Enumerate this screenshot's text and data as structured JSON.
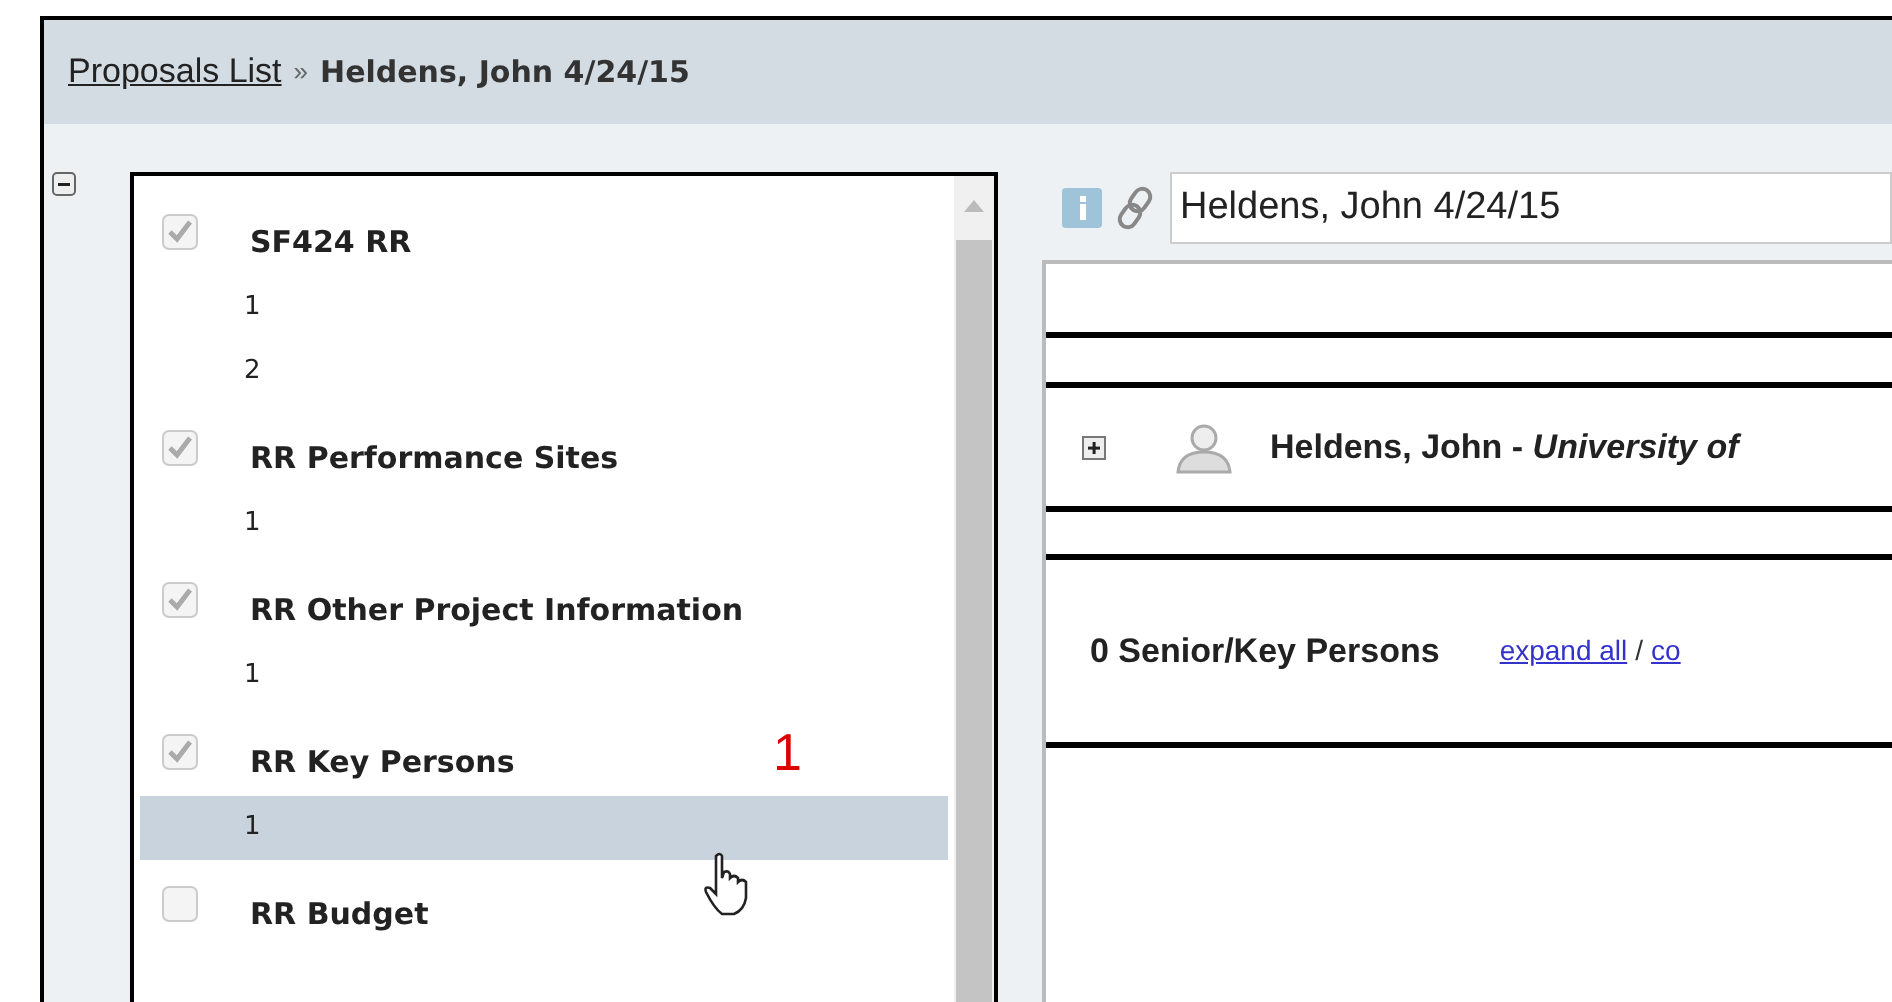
{
  "breadcrumb": {
    "link": "Proposals List",
    "separator": "»",
    "current": "Heldens, John 4/24/15"
  },
  "forms": [
    {
      "label": "SF424 RR",
      "checked": true,
      "items": [
        {
          "label": "1",
          "selected": false
        },
        {
          "label": "2",
          "selected": false
        }
      ]
    },
    {
      "label": "RR Performance Sites",
      "checked": true,
      "items": [
        {
          "label": "1",
          "selected": false
        }
      ]
    },
    {
      "label": "RR Other Project Information",
      "checked": true,
      "items": [
        {
          "label": "1",
          "selected": false
        }
      ]
    },
    {
      "label": "RR Key Persons",
      "checked": true,
      "items": [
        {
          "label": "1",
          "selected": true
        }
      ]
    },
    {
      "label": "RR Budget",
      "checked": false
    }
  ],
  "annotation": "1",
  "title_field": {
    "value": "Heldens, John 4/24/15"
  },
  "person": {
    "expanded": false,
    "text": "Heldens, John - *University of*"
  },
  "summary": {
    "count_label": "0 Senior/Key Persons",
    "links": [
      "expand all",
      "co"
    ],
    "separator": "/"
  }
}
